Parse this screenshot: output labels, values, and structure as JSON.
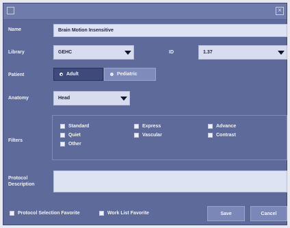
{
  "window": {
    "close_glyph": "×"
  },
  "name": {
    "label": "Name",
    "value": "Brain Motion Insensitive"
  },
  "library": {
    "label": "Library",
    "value": "GEHC"
  },
  "id": {
    "label": "ID",
    "value": "1.37"
  },
  "patient": {
    "label": "Patient",
    "options": [
      "Adult",
      "Pediatric"
    ],
    "selected": "Adult"
  },
  "anatomy": {
    "label": "Anatomy",
    "value": "Head"
  },
  "filters": {
    "label": "Filters",
    "items": [
      "Standard",
      "Express",
      "Advance",
      "Quiet",
      "Vascular",
      "Contrast",
      "Other"
    ]
  },
  "description": {
    "label_line1": "Protocol",
    "label_line2": "Description",
    "value": ""
  },
  "footer": {
    "protocol_favorite": "Protocol Selection Favorite",
    "worklist_favorite": "Work List Favorite",
    "save": "Save",
    "cancel": "Cancel"
  },
  "colors": {
    "panel": "#5d6a9a",
    "field": "#dde3f2",
    "selected_segment": "#3f4a7a"
  }
}
